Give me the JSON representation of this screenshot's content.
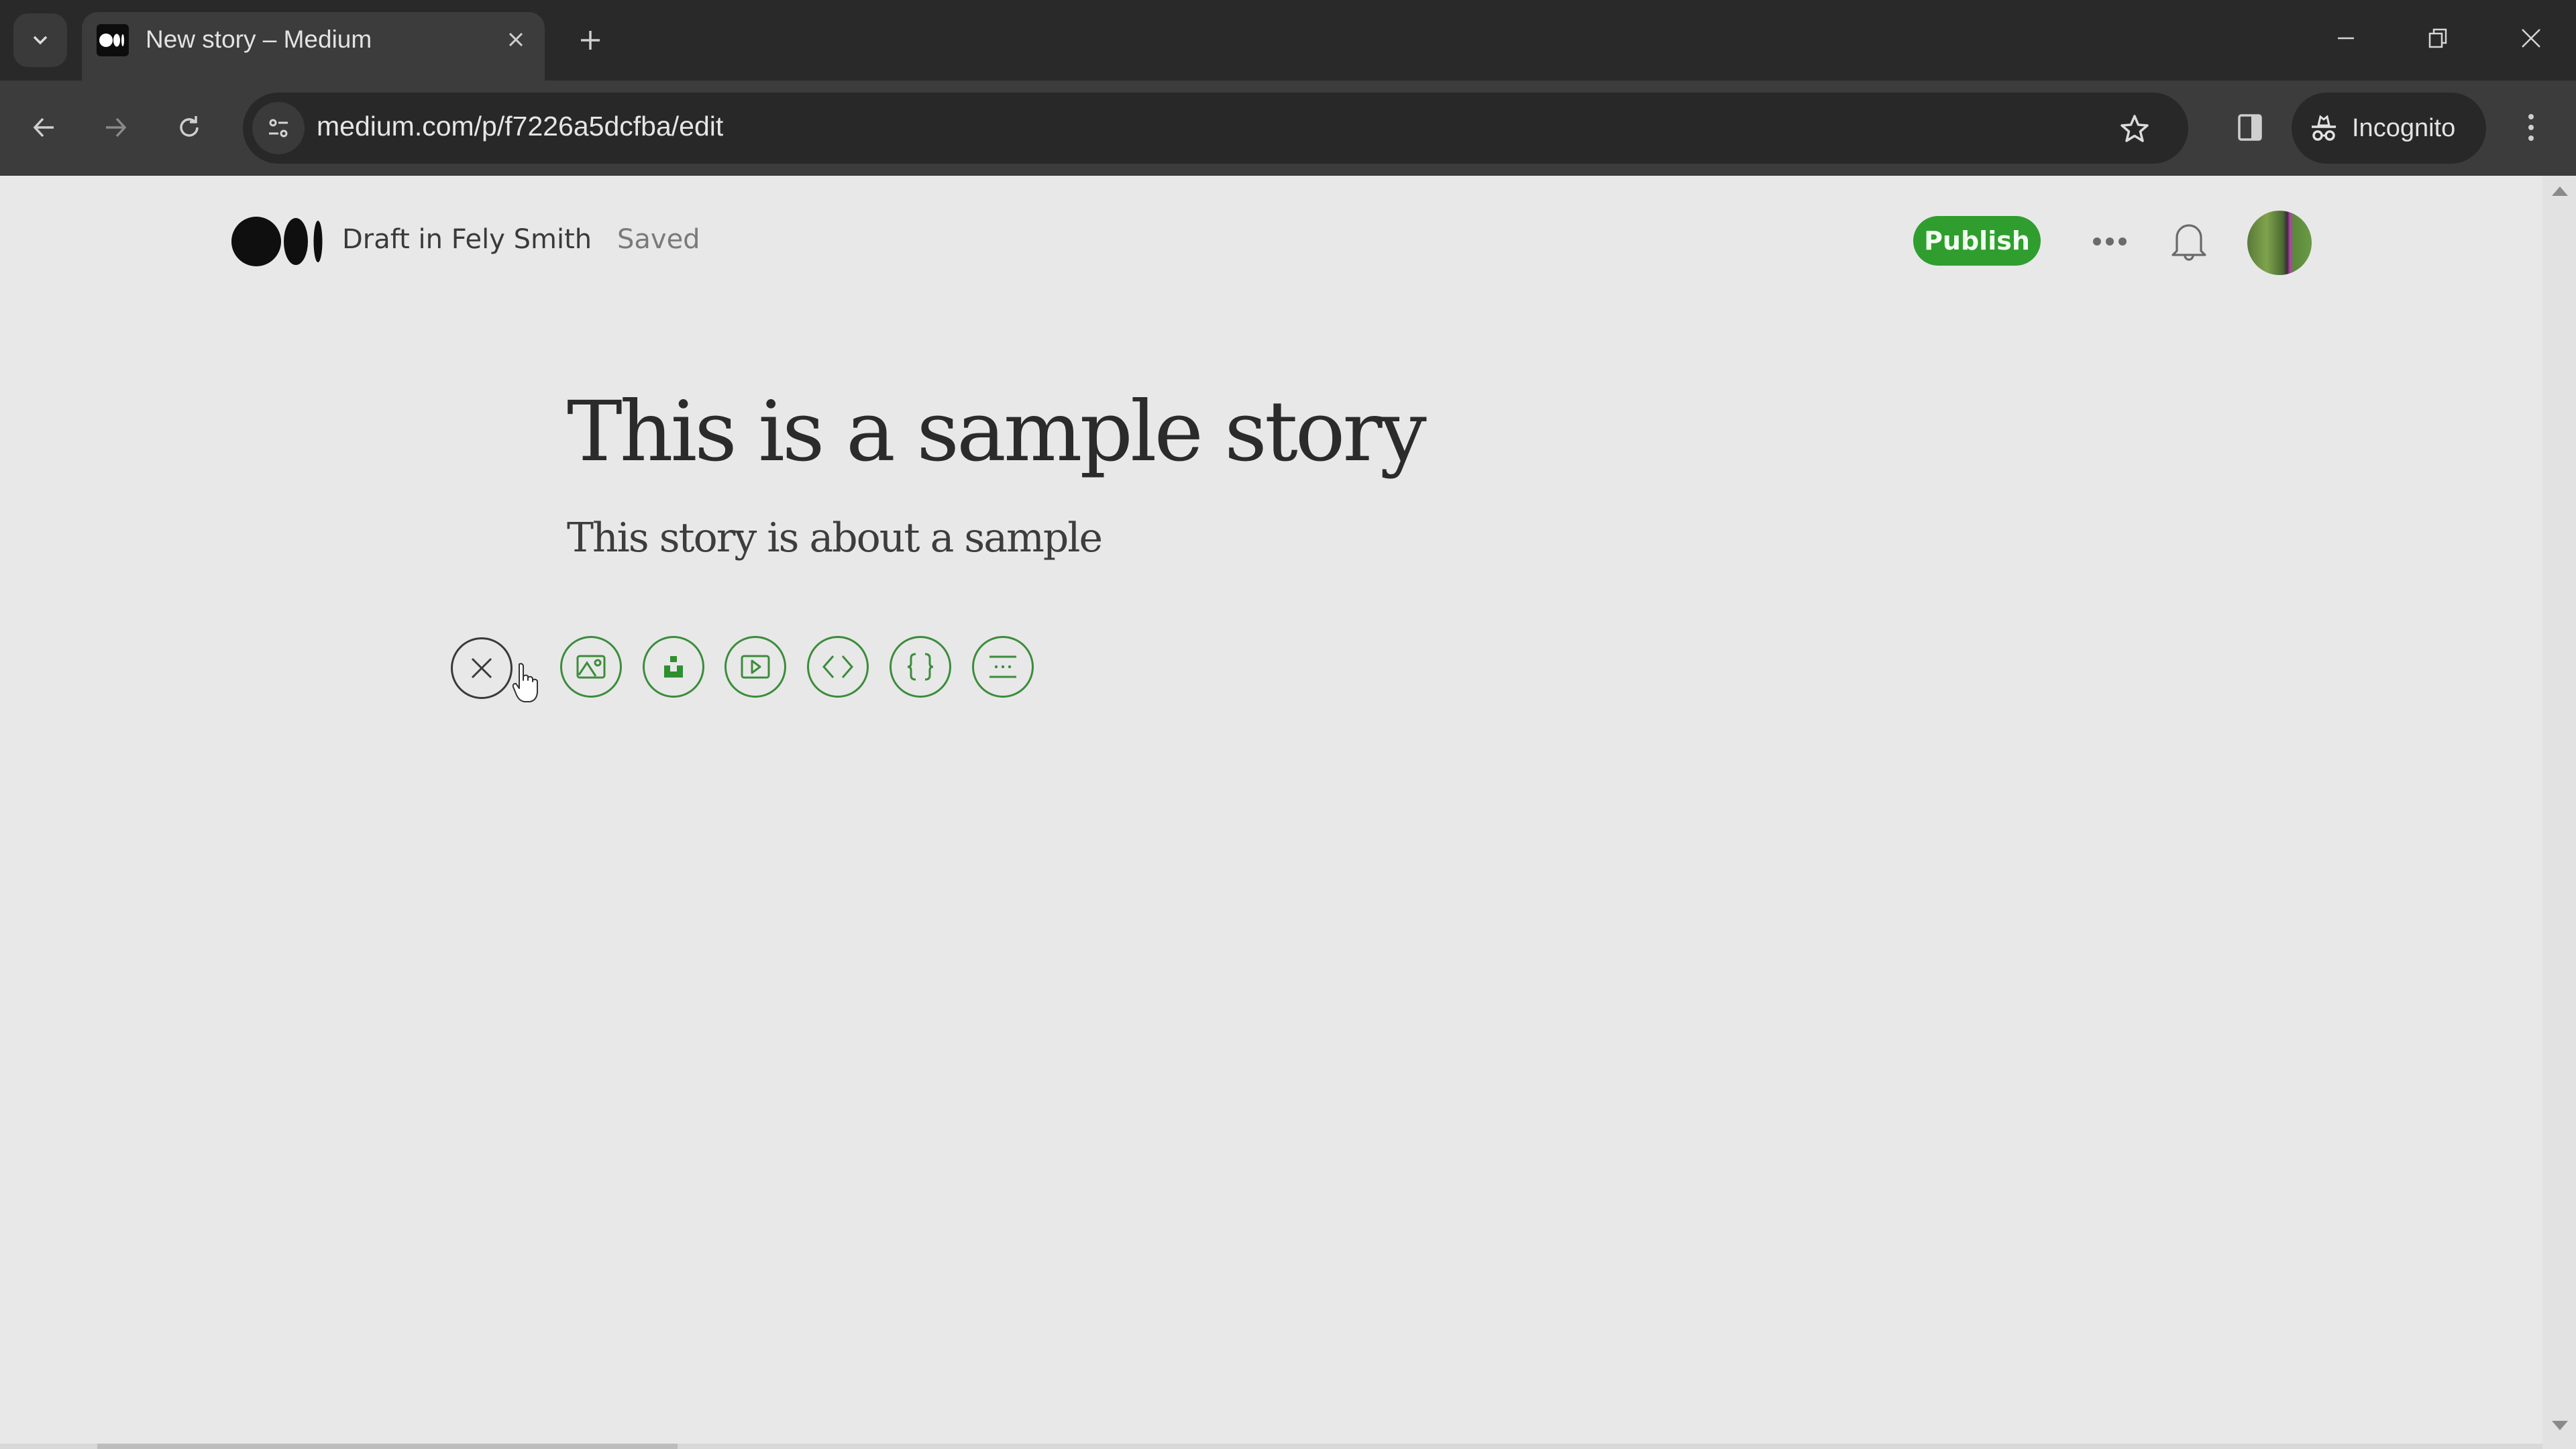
{
  "browser": {
    "tab": {
      "title": "New story – Medium",
      "favicon": "medium-logo-icon"
    },
    "address_bar": {
      "url": "medium.com/p/f7226a5dcfba/edit"
    },
    "profile_label": "Incognito",
    "icons": {
      "tab_search": "chevron-down-icon",
      "close_tab": "close-icon",
      "new_tab": "plus-icon",
      "back": "arrow-left-icon",
      "forward": "arrow-right-icon",
      "reload": "reload-icon",
      "site_info": "tune-icon",
      "bookmark": "star-icon",
      "side_panel": "side-panel-icon",
      "incognito": "incognito-icon",
      "menu": "kebab-menu-icon",
      "minimize": "minimize-icon",
      "restore": "restore-icon",
      "close_window": "close-icon"
    }
  },
  "header": {
    "logo": "medium-logo",
    "draft_label": "Draft in Fely Smith",
    "status": "Saved",
    "publish_label": "Publish",
    "colors": {
      "publish_bg": "#2f9e2f",
      "accent_green": "#3c8c3c"
    }
  },
  "story": {
    "title": "This is a sample story",
    "subtitle": "This story is about a sample"
  },
  "insert_toolbar": {
    "buttons": [
      {
        "name": "close",
        "icon": "close-icon"
      },
      {
        "name": "add-image",
        "icon": "image-icon"
      },
      {
        "name": "unsplash",
        "icon": "unsplash-icon"
      },
      {
        "name": "add-video",
        "icon": "video-icon"
      },
      {
        "name": "embed",
        "icon": "code-icon"
      },
      {
        "name": "code-block",
        "icon": "braces-icon"
      },
      {
        "name": "new-part",
        "icon": "separator-icon"
      }
    ]
  }
}
